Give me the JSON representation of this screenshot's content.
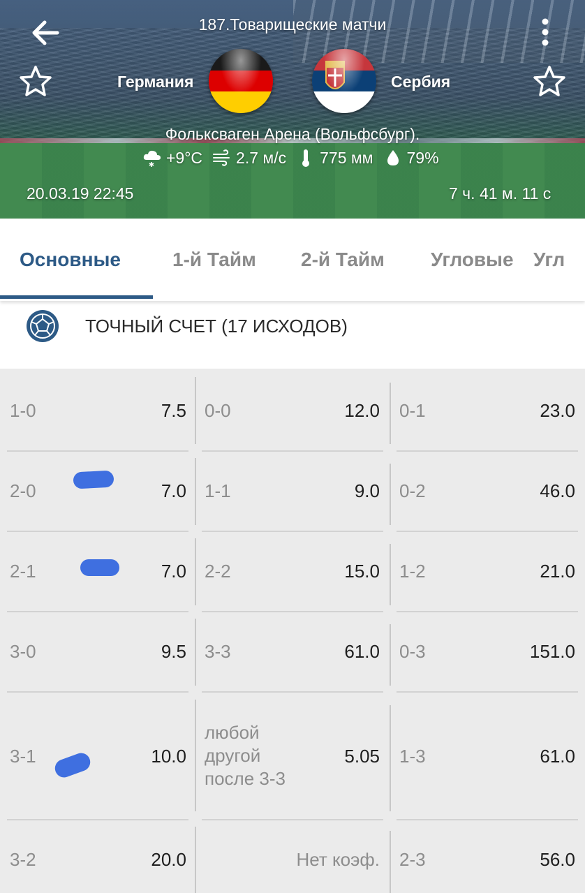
{
  "header": {
    "title": "187.Товарищеские матчи",
    "home_team": "Германия",
    "away_team": "Сербия",
    "venue": "Фольксваген Арена (Вольфсбург).",
    "weather": {
      "temperature": "+9°C",
      "wind": "2.7 м/с",
      "pressure": "775 мм",
      "humidity": "79%"
    },
    "datetime": "20.03.19 22:45",
    "countdown": "7 ч. 41 м. 11 с"
  },
  "tabs": [
    {
      "label": "Основные",
      "active": true
    },
    {
      "label": "1-й  Тайм",
      "active": false
    },
    {
      "label": "2-й  Тайм",
      "active": false
    },
    {
      "label": "Угловые",
      "active": false
    },
    {
      "label": "Угл",
      "active": false
    }
  ],
  "market": {
    "title": "ТОЧНЫЙ СЧЕТ (17 ИСХОДОВ)"
  },
  "outcomes": {
    "r0": [
      {
        "score": "1-0",
        "odds": "7.5"
      },
      {
        "score": "0-0",
        "odds": "12.0"
      },
      {
        "score": "0-1",
        "odds": "23.0"
      }
    ],
    "r1": [
      {
        "score": "2-0",
        "odds": "7.0"
      },
      {
        "score": "1-1",
        "odds": "9.0"
      },
      {
        "score": "0-2",
        "odds": "46.0"
      }
    ],
    "r2": [
      {
        "score": "2-1",
        "odds": "7.0"
      },
      {
        "score": "2-2",
        "odds": "15.0"
      },
      {
        "score": "1-2",
        "odds": "21.0"
      }
    ],
    "r3": [
      {
        "score": "3-0",
        "odds": "9.5"
      },
      {
        "score": "3-3",
        "odds": "61.0"
      },
      {
        "score": "0-3",
        "odds": "151.0"
      }
    ],
    "r4": [
      {
        "score": "3-1",
        "odds": "10.0"
      },
      {
        "score": "любой другой после 3-3",
        "odds": "5.05"
      },
      {
        "score": "1-3",
        "odds": "61.0"
      }
    ],
    "r5": [
      {
        "score": "3-2",
        "odds": "20.0"
      },
      {
        "score": "",
        "odds": "Нет коэф."
      },
      {
        "score": "2-3",
        "odds": "56.0"
      }
    ]
  },
  "colors": {
    "accent": "#2d5a86",
    "highlight_mark": "#3f6fe0",
    "grid_bg": "#ebebeb"
  }
}
